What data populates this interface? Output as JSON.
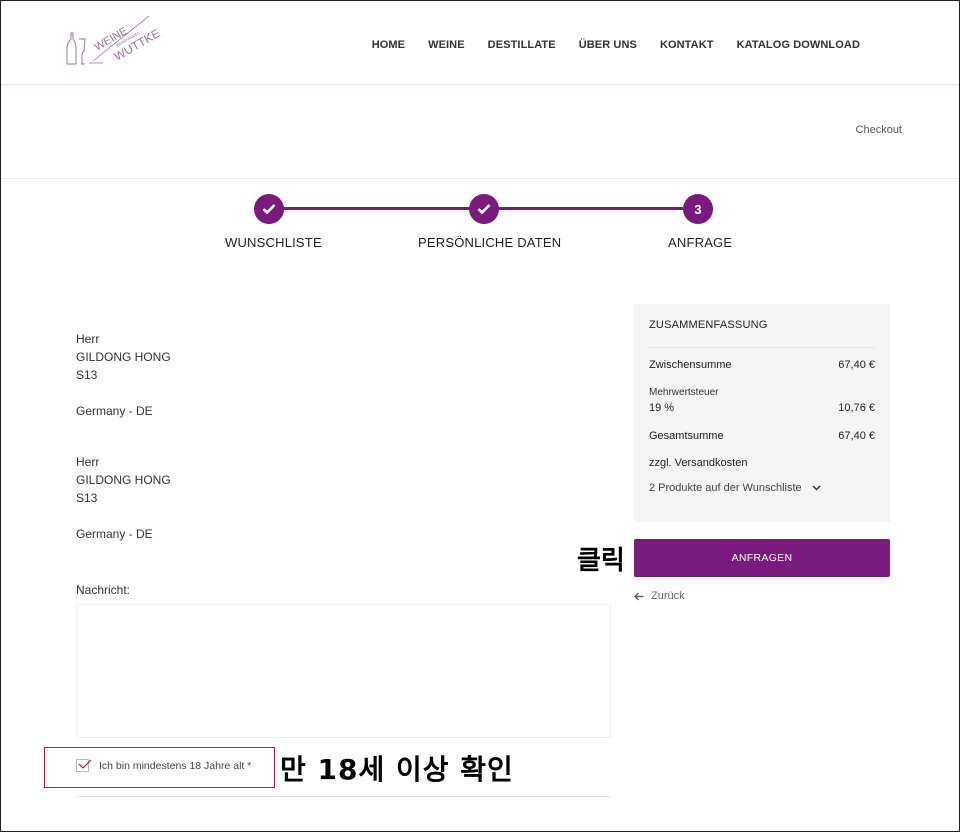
{
  "header": {
    "logo_text_top": "WEINE",
    "logo_text_bottom": "WUTTKE",
    "logo_text_small": "WEINHANDEL",
    "nav": [
      "HOME",
      "WEINE",
      "DESTILLATE",
      "ÜBER UNS",
      "KONTAKT",
      "KATALOG DOWNLOAD"
    ]
  },
  "breadcrumb": "Checkout",
  "steps": [
    {
      "label": "WUNSCHLISTE",
      "done": true
    },
    {
      "label": "PERSÖNLICHE DATEN",
      "done": true
    },
    {
      "label": "ANFRAGE",
      "number": "3",
      "done": false
    }
  ],
  "address1": {
    "salutation": "Herr",
    "name": "GILDONG HONG",
    "street": "S13",
    "country": "Germany - DE"
  },
  "address2": {
    "salutation": "Herr",
    "name": "GILDONG HONG",
    "street": "S13",
    "country": "Germany - DE"
  },
  "message": {
    "label": "Nachricht:",
    "value": ""
  },
  "age_check": {
    "label": "Ich bin mindestens 18 Jahre alt *",
    "checked": true
  },
  "annotations": {
    "click": "클릭",
    "age": "만 18세 이상 확인"
  },
  "summary": {
    "title": "ZUSAMMENFASSUNG",
    "subtotal_label": "Zwischensumme",
    "subtotal_value": "67,40 €",
    "vat_label": "Mehrwertsteuer",
    "vat_rate": "19 %",
    "vat_value": "10,76 €",
    "total_label": "Gesamtsumme",
    "total_value": "67,40 €",
    "shipping_note": "zzgl. Versandkosten",
    "products_toggle": "2 Produkte auf der Wunschliste"
  },
  "actions": {
    "submit": "ANFRAGEN",
    "back": "Zurück"
  },
  "colors": {
    "accent": "#7b1a7e",
    "annotation_border": "#c0182a"
  }
}
